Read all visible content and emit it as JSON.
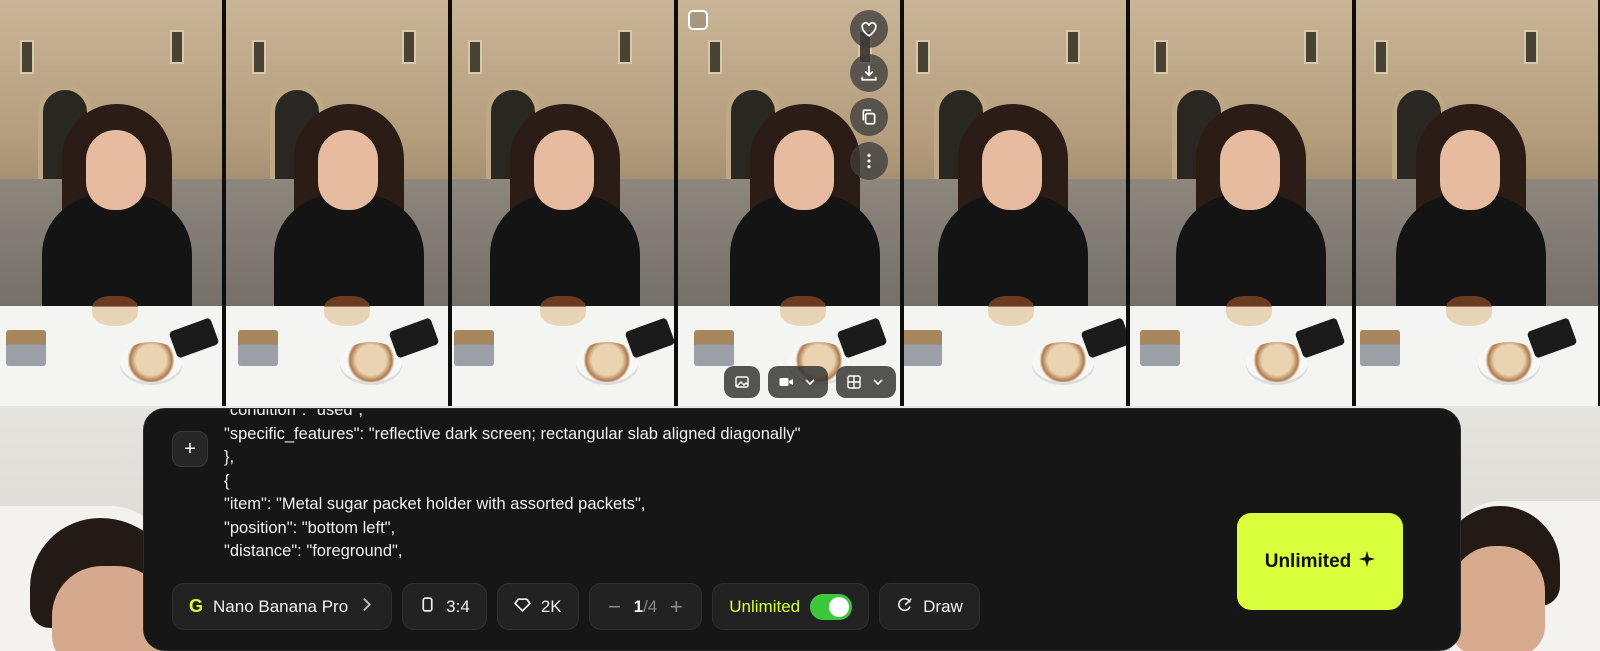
{
  "gallery": {
    "tile_count": 7,
    "selected_tile_index": 3
  },
  "tile_actions": {
    "icons": [
      "heart-icon",
      "download-icon",
      "copy-icon",
      "more-vertical-icon"
    ]
  },
  "tile_toolbar": {
    "icons": [
      "image-icon",
      "video-icon",
      "chevron-down-icon",
      "grid-icon",
      "chevron-down-icon"
    ]
  },
  "prompt": {
    "lines": [
      "\"condition\": \"used\",",
      "\"specific_features\": \"reflective dark screen; rectangular slab aligned diagonally\"",
      "},",
      "{",
      "\"item\": \"Metal sugar packet holder with assorted packets\",",
      "\"position\": \"bottom left\",",
      "\"distance\": \"foreground\","
    ]
  },
  "controls": {
    "model": {
      "logo": "G",
      "label": "Nano Banana Pro"
    },
    "aspect": {
      "label": "3:4"
    },
    "quality": {
      "label": "2K"
    },
    "count": {
      "current": "1",
      "total": "/4",
      "minus": "−",
      "plus": "+"
    },
    "unlimited": {
      "label": "Unlimited",
      "enabled": true
    },
    "draw": {
      "label": "Draw"
    }
  },
  "generate_button": {
    "label": "Unlimited"
  },
  "colors": {
    "accent": "#daff3d",
    "toggle_on": "#3cc83a",
    "panel_bg": "#161616"
  }
}
